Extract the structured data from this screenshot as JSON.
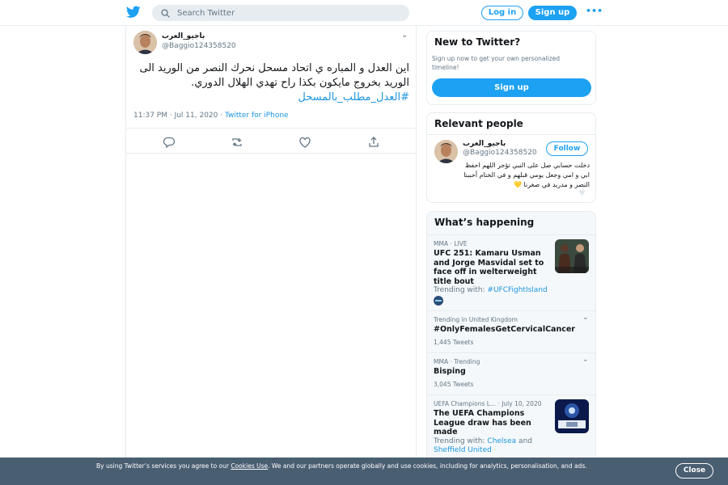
{
  "header": {
    "search_placeholder": "Search Twitter",
    "login_label": "Log in",
    "signup_label": "Sign up",
    "more_label": "•••"
  },
  "tweet": {
    "name": "باجيو_العرب",
    "handle": "@Baggio124358520",
    "text": "اين العدل و المباره ي اتحاد مسحل نحرك النصر من الوريد الى الوريد بخروج مايكون بكذا راح تهدي الهلال الدوري.",
    "hashtag": "#العدل_مطلب_بالمسحل",
    "time": "11:37 PM · Jul 11, 2020 · ",
    "client": "Twitter for iPhone"
  },
  "new_to_twitter": {
    "title": "New to Twitter?",
    "subtitle": "Sign up now to get your own personalized timeline!",
    "button": "Sign up"
  },
  "relevant": {
    "title": "Relevant people",
    "name": "باجيو_العرب",
    "handle": "@Baggio124358520",
    "follow": "Follow",
    "bio": "دخلت حسابي صل على النبي تؤجر اللهم احفظ ابي و امي وجعل يومي قبلهم و في الختام أحببنا النصر و مدريد في صغرنا",
    "bio_emoji": "💛"
  },
  "happening": {
    "title": "What’s happening",
    "items": [
      {
        "meta": "MMA · LIVE",
        "title": "UFC 251: Kamaru Usman and Jorge Masvidal set to face off in welterweight title bout",
        "trend_prefix": "Trending with: ",
        "trend_link": "#UFCFightIsland"
      },
      {
        "meta": "Trending in United Kingdom",
        "title": "#OnlyFemalesGetCervicalCancer",
        "count": "1,445 Tweets"
      },
      {
        "meta": "MMA · Trending",
        "title": "Bisping",
        "count": "3,045 Tweets"
      },
      {
        "meta": "UEFA Champions L... · July 10, 2020",
        "title": "The UEFA Champions League draw has been made",
        "trend_prefix": "Trending with: ",
        "trend_link": "Chelsea",
        "trend_and": " and ",
        "trend_link2": "Sheffield United"
      }
    ]
  },
  "cookie": {
    "text_before": "By using Twitter’s services you agree to our ",
    "link": "Cookies Use",
    "text_after": ". We and our partners operate globally and use cookies, including for analytics, personalisation, and ads.",
    "close": "Close"
  },
  "colors": {
    "accent": "#1da1f2",
    "link": "#1b95e0",
    "cookie_bg": "#4a5e72"
  }
}
